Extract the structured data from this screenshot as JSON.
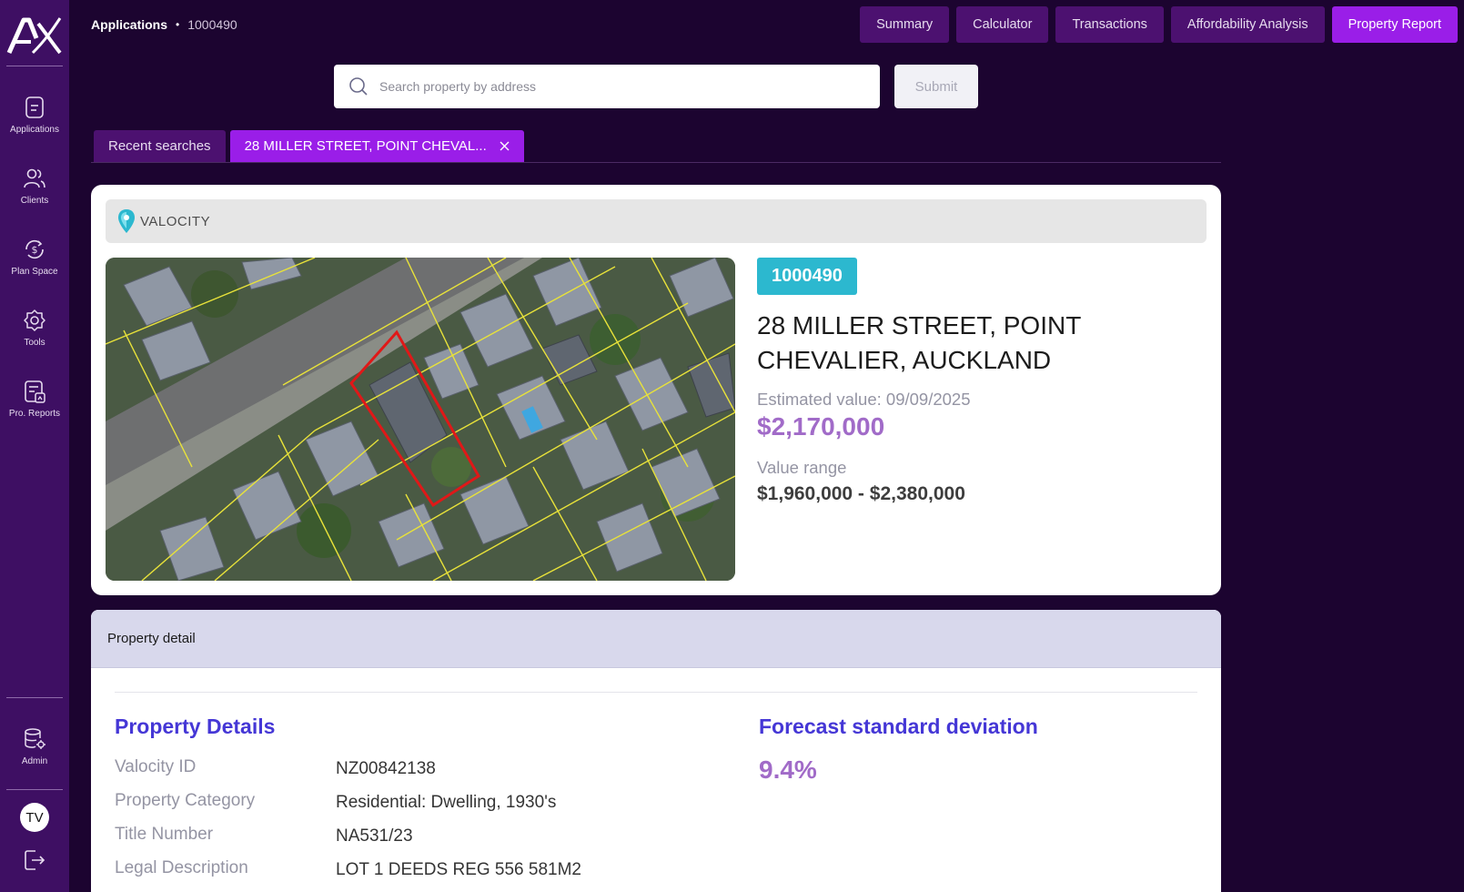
{
  "app": {
    "logo_text": "AX"
  },
  "sidebar": {
    "items": [
      {
        "label": "Applications",
        "icon": "document-icon"
      },
      {
        "label": "Clients",
        "icon": "users-icon"
      },
      {
        "label": "Plan Space",
        "icon": "dollar-cycle-icon"
      },
      {
        "label": "Tools",
        "icon": "gear-icon"
      },
      {
        "label": "Pro. Reports",
        "icon": "report-icon"
      }
    ],
    "admin_label": "Admin",
    "avatar_initials": "TV"
  },
  "breadcrumb": {
    "section": "Applications",
    "separator": "•",
    "id": "1000490"
  },
  "top_tabs": [
    "Summary",
    "Calculator",
    "Transactions",
    "Affordability Analysis",
    "Property Report"
  ],
  "active_tab": "Property Report",
  "search": {
    "placeholder": "Search property by address",
    "submit_label": "Submit"
  },
  "sub_tabs": {
    "recent_label": "Recent searches",
    "current_label": "28 MILLER STREET, POINT CHEVAL..."
  },
  "property": {
    "provider": "VALOCITY",
    "id_badge": "1000490",
    "address": "28 MILLER STREET, POINT CHEVALIER, AUCKLAND",
    "estimated_label": "Estimated value: 09/09/2025",
    "estimated_value": "$2,170,000",
    "range_label": "Value range",
    "range_value": "$1,960,000 - $2,380,000"
  },
  "detail": {
    "header": "Property detail",
    "details_title": "Property Details",
    "rows": [
      {
        "label": "Valocity ID",
        "value": "NZ00842138"
      },
      {
        "label": "Property Category",
        "value": "Residential: Dwelling, 1930's"
      },
      {
        "label": "Title Number",
        "value": "NA531/23"
      },
      {
        "label": "Legal Description",
        "value": "LOT 1 DEEDS REG 556 581M2"
      }
    ],
    "forecast_title": "Forecast standard deviation",
    "forecast_value": "9.4%"
  },
  "colors": {
    "background": "#1c0430",
    "sidebar": "#3e0f63",
    "tab": "#4c1170",
    "active_tab": "#9a1ee8",
    "badge": "#2cb8cf",
    "value_purple": "#a16bc8",
    "heading_blue": "#4537d6"
  }
}
